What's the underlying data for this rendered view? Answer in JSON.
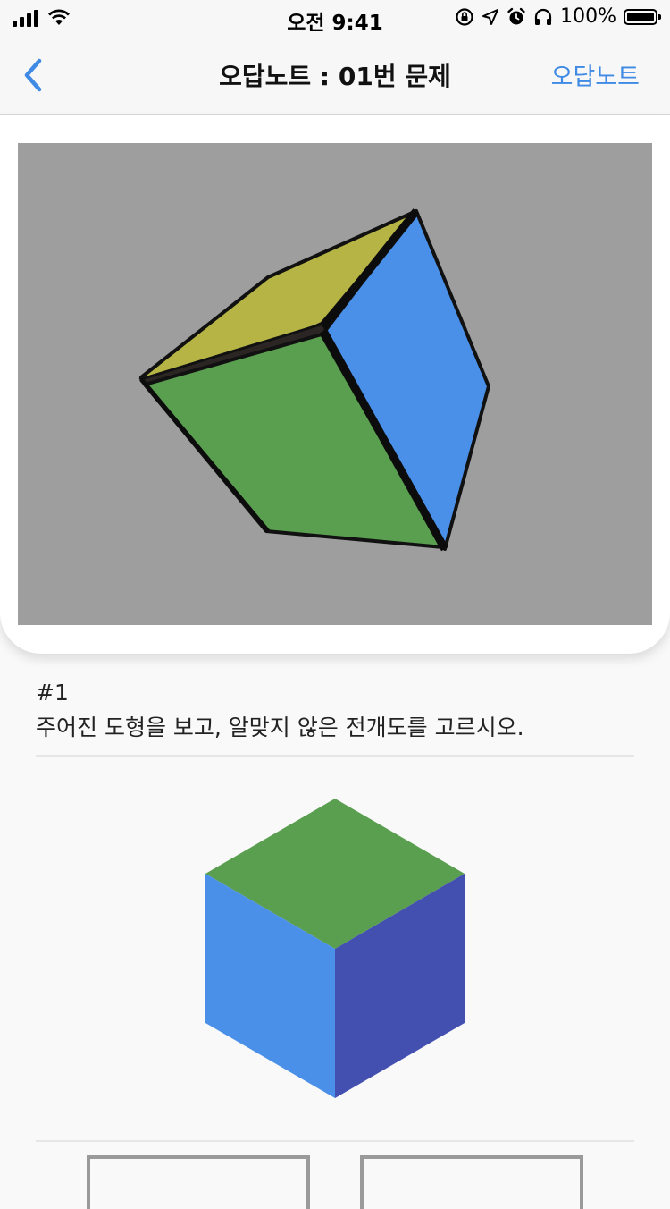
{
  "status_bar": {
    "time": "오전 9:41",
    "battery": "100%"
  },
  "nav": {
    "title": "오답노트 : 01번 문제",
    "right_label": "오답노트"
  },
  "colors": {
    "accent": "#3f8ae4",
    "viewer_bg": "#9e9e9e",
    "face_yellow": "#b5b445",
    "face_blue": "#4a90e8",
    "face_green": "#5a9e50",
    "face_indigo": "#4350b0"
  },
  "question": {
    "number": "#1",
    "text": "주어진 도형을 보고, 알맞지 않은 전개도를 고르시오."
  },
  "icons": {
    "back": "chevron-left-icon",
    "wifi": "wifi-icon",
    "lock": "orientation-lock-icon",
    "location": "location-arrow-icon",
    "alarm": "alarm-icon",
    "headphones": "headphones-icon"
  }
}
